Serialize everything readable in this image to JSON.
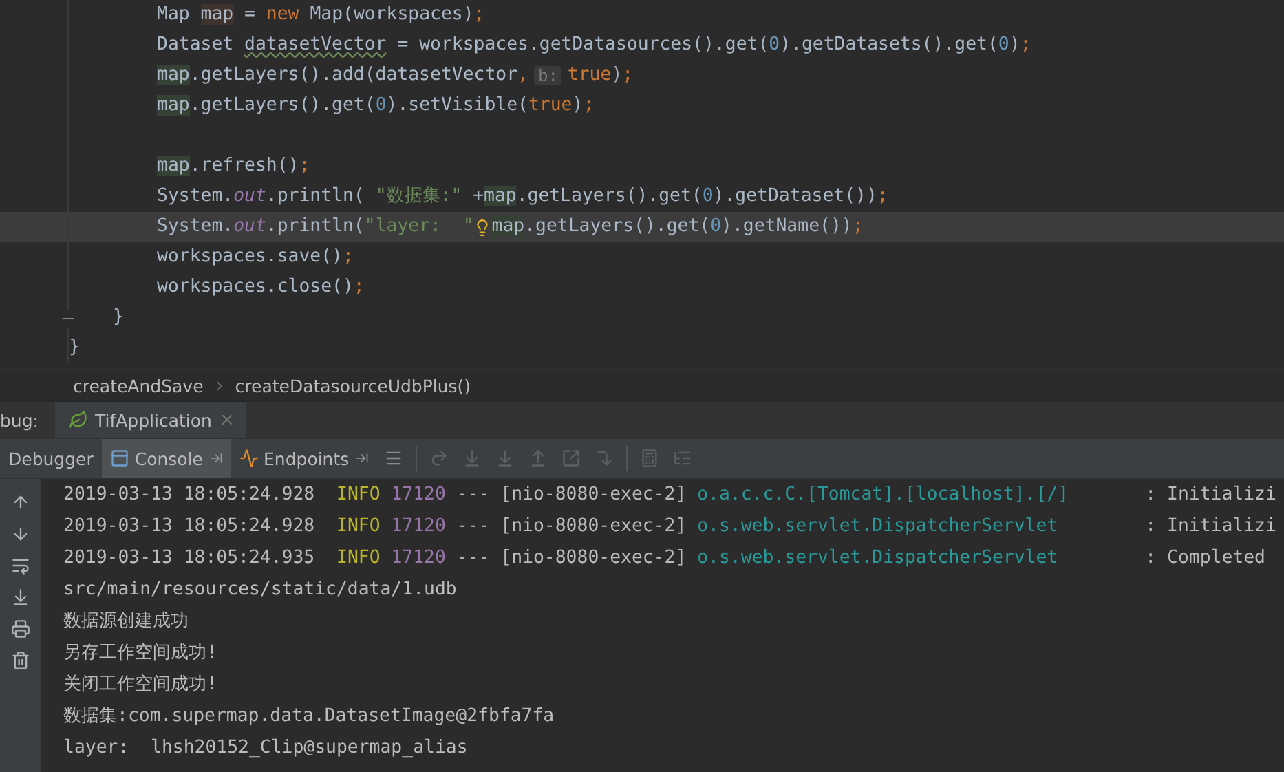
{
  "editor": {
    "lines": [
      {
        "current": false,
        "fold": false,
        "segments": [
          {
            "kind": "code",
            "tokens": [
              {
                "kind": "plain",
                "text": "}"
              }
            ]
          }
        ],
        "children": [
          {
            "current": false,
            "fold": true,
            "segments": [
              {
                "kind": "code",
                "tokens": [
                  {
                    "kind": "plain",
                    "text": "}"
                  }
                ]
              }
            ],
            "children": [
              {
                "current": false,
                "fold": false,
                "segments": [
                  {
                    "kind": "code",
                    "tokens": [
                      {
                        "kind": "plain",
                        "text": "Map "
                      },
                      {
                        "kind": "decl",
                        "text": "map"
                      },
                      {
                        "kind": "plain",
                        "text": " = "
                      },
                      {
                        "kind": "keyword",
                        "text": "new"
                      },
                      {
                        "kind": "plain",
                        "text": " Map(workspaces)"
                      },
                      {
                        "kind": "semi",
                        "text": ";"
                      }
                    ]
                  }
                ]
              },
              {
                "current": false,
                "fold": false,
                "segments": [
                  {
                    "kind": "code",
                    "tokens": [
                      {
                        "kind": "plain",
                        "text": "Dataset "
                      },
                      {
                        "kind": "warn",
                        "text": "datasetVector"
                      },
                      {
                        "kind": "plain",
                        "text": " = workspaces.getDatasources().get("
                      },
                      {
                        "kind": "number",
                        "text": "0"
                      },
                      {
                        "kind": "plain",
                        "text": ").getDatasets().get("
                      },
                      {
                        "kind": "number",
                        "text": "0"
                      },
                      {
                        "kind": "plain",
                        "text": ")"
                      },
                      {
                        "kind": "semi",
                        "text": ";"
                      }
                    ]
                  }
                ]
              },
              {
                "current": false,
                "fold": false,
                "segments": [
                  {
                    "kind": "code",
                    "tokens": [
                      {
                        "kind": "usage",
                        "text": "map"
                      },
                      {
                        "kind": "plain",
                        "text": ".getLayers().add(datasetVector"
                      },
                      {
                        "kind": "keyword",
                        "text": ","
                      }
                    ]
                  },
                  {
                    "kind": "hint",
                    "text": "b:"
                  },
                  {
                    "kind": "code",
                    "tokens": [
                      {
                        "kind": "keyword",
                        "text": "true"
                      },
                      {
                        "kind": "plain",
                        "text": ")"
                      },
                      {
                        "kind": "semi",
                        "text": ";"
                      }
                    ]
                  }
                ]
              },
              {
                "current": false,
                "fold": false,
                "segments": [
                  {
                    "kind": "code",
                    "tokens": [
                      {
                        "kind": "usage",
                        "text": "map"
                      },
                      {
                        "kind": "plain",
                        "text": ".getLayers().get("
                      },
                      {
                        "kind": "number",
                        "text": "0"
                      },
                      {
                        "kind": "plain",
                        "text": ").setVisible("
                      },
                      {
                        "kind": "keyword",
                        "text": "true"
                      },
                      {
                        "kind": "plain",
                        "text": ")"
                      },
                      {
                        "kind": "semi",
                        "text": ";"
                      }
                    ]
                  }
                ]
              },
              {
                "current": false,
                "fold": false
              },
              {
                "current": false,
                "fold": false,
                "segments": [
                  {
                    "kind": "code",
                    "tokens": [
                      {
                        "kind": "usage",
                        "text": "map"
                      },
                      {
                        "kind": "plain",
                        "text": ".refresh()"
                      },
                      {
                        "kind": "semi",
                        "text": ";"
                      }
                    ]
                  }
                ]
              },
              {
                "current": false,
                "fold": false,
                "segments": [
                  {
                    "kind": "code",
                    "tokens": [
                      {
                        "kind": "plain",
                        "text": "System."
                      },
                      {
                        "kind": "static",
                        "text": "out"
                      },
                      {
                        "kind": "plain",
                        "text": ".println( "
                      },
                      {
                        "kind": "string",
                        "text": "\"数据集:\""
                      },
                      {
                        "kind": "plain",
                        "text": " +"
                      },
                      {
                        "kind": "usage",
                        "text": "map"
                      },
                      {
                        "kind": "plain",
                        "text": ".getLayers().get("
                      },
                      {
                        "kind": "number",
                        "text": "0"
                      },
                      {
                        "kind": "plain",
                        "text": ").getDataset())"
                      },
                      {
                        "kind": "semi",
                        "text": ";"
                      }
                    ]
                  }
                ]
              },
              {
                "current": true,
                "fold": false,
                "segments": [
                  {
                    "kind": "code",
                    "tokens": [
                      {
                        "kind": "plain",
                        "text": "System."
                      },
                      {
                        "kind": "static",
                        "text": "out"
                      },
                      {
                        "kind": "plain",
                        "text": ".println("
                      },
                      {
                        "kind": "string",
                        "text": "\"layer:  \""
                      }
                    ]
                  },
                  {
                    "kind": "bulb"
                  },
                  {
                    "kind": "code",
                    "tokens": [
                      {
                        "kind": "usage",
                        "text": "map"
                      },
                      {
                        "kind": "plain",
                        "text": ".getLayers().get("
                      },
                      {
                        "kind": "number",
                        "text": "0"
                      },
                      {
                        "kind": "plain",
                        "text": ").getName())"
                      },
                      {
                        "kind": "semi",
                        "text": ";"
                      }
                    ]
                  }
                ]
              },
              {
                "current": false,
                "fold": false,
                "segments": [
                  {
                    "kind": "code",
                    "tokens": [
                      {
                        "kind": "plain",
                        "text": "workspaces.save()"
                      },
                      {
                        "kind": "semi",
                        "text": ";"
                      }
                    ]
                  }
                ]
              },
              {
                "current": false,
                "fold": false,
                "segments": [
                  {
                    "kind": "code",
                    "tokens": [
                      {
                        "kind": "plain",
                        "text": "workspaces.close()"
                      },
                      {
                        "kind": "semi",
                        "text": ";"
                      }
                    ]
                  }
                ]
              }
            ]
          }
        ]
      }
    ]
  },
  "breadcrumbs": [
    "createAndSave",
    "createDatasourceUdbPlus()"
  ],
  "debug": {
    "label": "bug:",
    "tabs": [
      {
        "label": "TifApplication",
        "selected": true
      }
    ]
  },
  "toolbar_tabs": [
    {
      "label": "Debugger",
      "selected": false
    },
    {
      "label": "Console",
      "selected": true
    },
    {
      "label": "Endpoints",
      "selected": false
    }
  ],
  "console": {
    "lines": [
      {
        "kind": "log",
        "time": "2019-03-13 18:05:24.928",
        "level": "INFO",
        "pid": "17120",
        "sep": "---",
        "thread": "[nio-8080-exec-2]",
        "logger": "o.a.c.c.C.[Tomcat].[localhost].[/]",
        "message": ": Initializi"
      },
      {
        "kind": "log",
        "time": "2019-03-13 18:05:24.928",
        "level": "INFO",
        "pid": "17120",
        "sep": "---",
        "thread": "[nio-8080-exec-2]",
        "logger": "o.s.web.servlet.DispatcherServlet",
        "message": ": Initializi"
      },
      {
        "kind": "log",
        "time": "2019-03-13 18:05:24.935",
        "level": "INFO",
        "pid": "17120",
        "sep": "---",
        "thread": "[nio-8080-exec-2]",
        "logger": "o.s.web.servlet.DispatcherServlet",
        "message": ": Completed"
      },
      {
        "kind": "text",
        "text": "src/main/resources/static/data/1.udb"
      },
      {
        "kind": "text",
        "text": "数据源创建成功"
      },
      {
        "kind": "text",
        "text": "另存工作空间成功!"
      },
      {
        "kind": "text",
        "text": "关闭工作空间成功!"
      },
      {
        "kind": "text",
        "text": "数据集:com.supermap.data.DatasetImage@2fbfa7fa"
      },
      {
        "kind": "text",
        "text": "layer:  lhsh20152_Clip@supermap_alias"
      }
    ]
  }
}
